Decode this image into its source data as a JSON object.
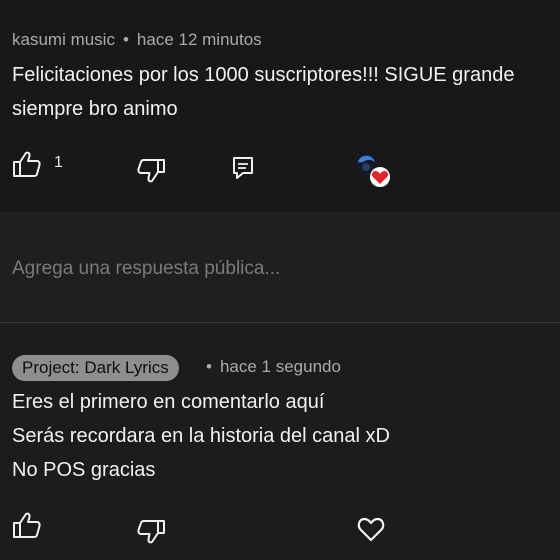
{
  "comment1": {
    "author": "kasumi music",
    "separator": "•",
    "time": "hace 12 minutos",
    "lines": [
      "Felicitaciones por los 1000 suscriptores!!! SIGUE grande",
      "siempre bro animo"
    ],
    "like_count": "1",
    "icons": {
      "like": "thumbs-up-icon",
      "dislike": "thumbs-down-icon",
      "reply": "reply-comment-icon",
      "creator_heart": "creator-heart-avatar-icon"
    }
  },
  "reply_box": {
    "placeholder": "Agrega una respuesta pública..."
  },
  "comment2": {
    "author": "Project: Dark Lyrics",
    "separator": "•",
    "time": "hace 1 segundo",
    "lines": [
      "Eres el primero en comentarlo aquí",
      "Serás recordara en la historia del canal xD",
      "No POS gracias"
    ],
    "icons": {
      "like": "thumbs-up-icon",
      "dislike": "thumbs-down-icon",
      "heart": "heart-outline-icon"
    }
  },
  "colors": {
    "background": "#181818",
    "text": "#f1f1f1",
    "meta": "#aaaaaa",
    "pill": "#8e8e8e",
    "heart": "#e8202a"
  }
}
